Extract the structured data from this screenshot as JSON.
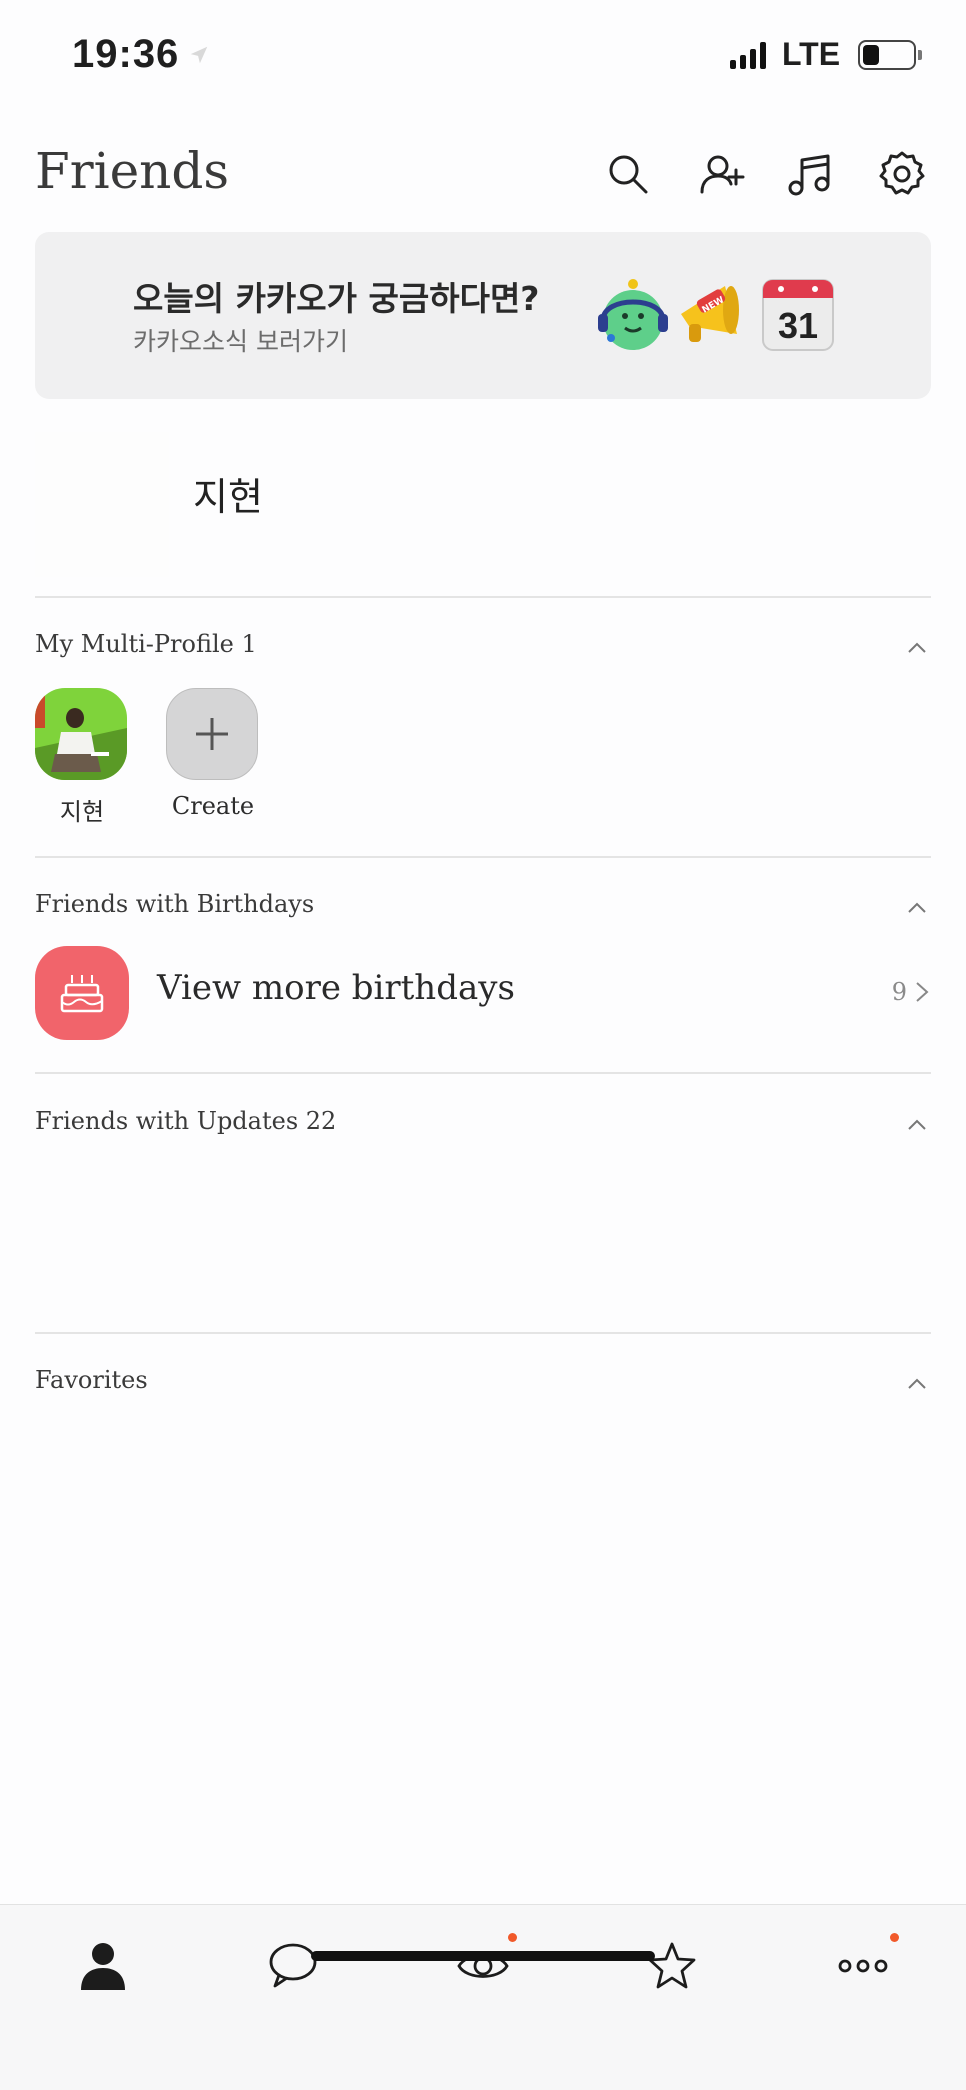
{
  "status_bar": {
    "time": "19:36",
    "network": "LTE"
  },
  "header": {
    "title": "Friends",
    "icons": [
      "search-icon",
      "add-friend-icon",
      "music-icon",
      "settings-icon"
    ]
  },
  "banner": {
    "title": "오늘의 카카오가 궁금하다면?",
    "subtitle": "카카오소식 보러가기",
    "new_tag": "NEW",
    "calendar_day": "31"
  },
  "my_profile": {
    "name": "지현"
  },
  "multi_profile": {
    "title": "My Multi-Profile 1",
    "items": [
      {
        "label": "지현"
      },
      {
        "label": "Create"
      }
    ]
  },
  "birthdays": {
    "title": "Friends with Birthdays",
    "row_label": "View more birthdays",
    "count": "9"
  },
  "updates": {
    "title": "Friends with Updates 22"
  },
  "favorites": {
    "title": "Favorites"
  },
  "tabbar": {
    "tabs": [
      "friends-tab",
      "chats-tab",
      "view-tab",
      "shopping-tab",
      "more-tab"
    ]
  },
  "colors": {
    "accent_dot": "#f1592a",
    "birthday": "#f1646b",
    "banner_bg": "#f0f0f1"
  }
}
